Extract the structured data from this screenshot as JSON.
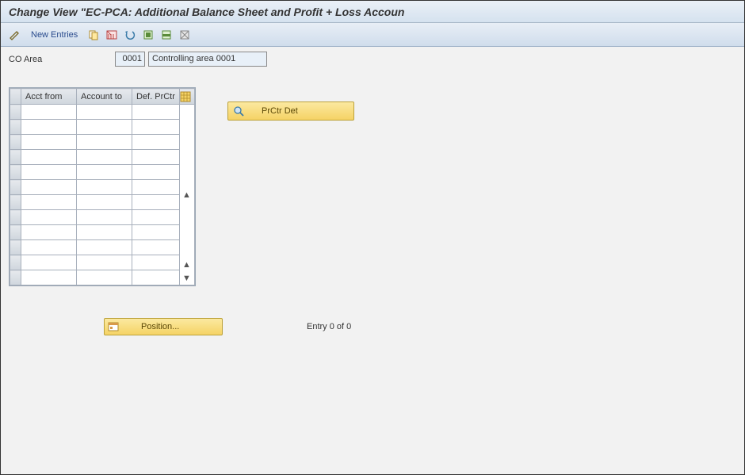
{
  "title": "Change View \"EC-PCA: Additional Balance Sheet and Profit + Loss Accoun",
  "toolbar": {
    "new_entries": "New Entries"
  },
  "co_area": {
    "label": "CO Area",
    "code": "0001",
    "desc": "Controlling area 0001"
  },
  "table": {
    "headers": {
      "acct_from": "Acct from",
      "account_to": "Account to",
      "def_prctr": "Def. PrCtr"
    }
  },
  "buttons": {
    "prctr_det": "PrCtr Det",
    "position": "Position..."
  },
  "status": {
    "entry": "Entry 0 of 0"
  }
}
